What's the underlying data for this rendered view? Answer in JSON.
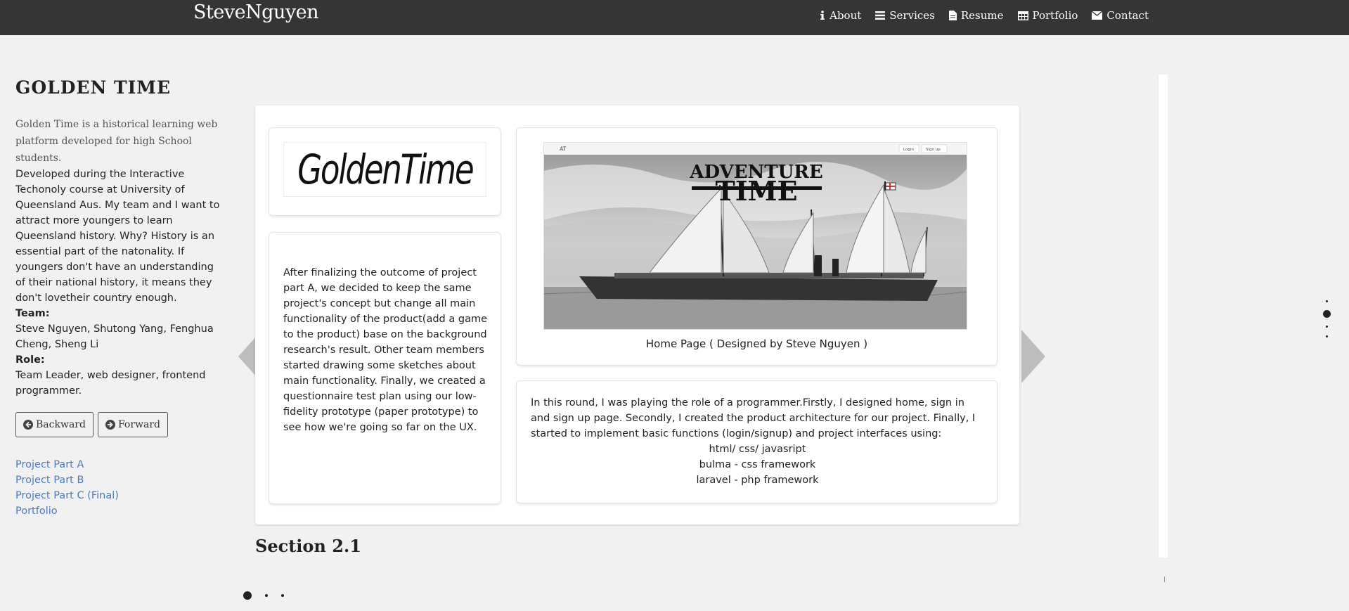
{
  "navbar": {
    "brand": "SteveNguyen",
    "items": [
      {
        "label": "About",
        "icon": "info-icon"
      },
      {
        "label": "Services",
        "icon": "list-icon"
      },
      {
        "label": "Resume",
        "icon": "document-icon"
      },
      {
        "label": "Portfolio",
        "icon": "grid-icon"
      },
      {
        "label": "Contact",
        "icon": "envelope-icon"
      }
    ]
  },
  "sidebar": {
    "title": "GOLDEN TIME",
    "intro": "Golden Time is a historical learning web platform developed for high School students.",
    "description": "Developed during the Interactive Techonoly course at University of Queensland Aus. My team and I want to attract more youngers to learn Queensland history. Why? History is an essential part of the natonality. If youngers don't have an understanding of their national history, it means they don't lovetheir country enough.",
    "team_label": "Team:",
    "team": "Steve Nguyen, Shutong Yang, Fenghua Cheng, Sheng Li",
    "role_label": "Role:",
    "role": "Team Leader, web designer, frontend programmer.",
    "backward_label": "Backward",
    "forward_label": "Forward",
    "links": [
      "Project Part A",
      "Project Part B",
      "Project Part C (Final)",
      "Portfolio"
    ]
  },
  "carousel": {
    "logo_text": "GoldenTime",
    "body_text": "After finalizing the outcome of project part A, we decided to keep the same project's concept but change all main functionality of the product(add a game to the product) base on the background research's result. Other team members started drawing some sketches about main functionality. Finally, we created a questionnaire test plan using our low-fidelity prototype (paper prototype) to see how we're going so far on the UX.",
    "image_title_line1": "ADVENTURE",
    "image_title_line2": "TIME",
    "image_login": "Login",
    "image_signup": "Sign up",
    "image_caption": "Home Page ( Designed by Steve Nguyen )",
    "role_text": "In this round, I was playing the role of a programmer.Firstly, I designed home, sign in and sign up page. Secondly, I created the product architecture for our project. Finally, I started to implement basic functions (login/signup) and project interfaces using:",
    "tech": [
      "html/ css/ javasript",
      "bulma - css framework",
      "laravel - php framework"
    ]
  },
  "section_label": "Section 2.1",
  "slide_indicator": {
    "total": 3,
    "active": 1
  },
  "section_indicator": {
    "total": 4,
    "active": 2
  }
}
